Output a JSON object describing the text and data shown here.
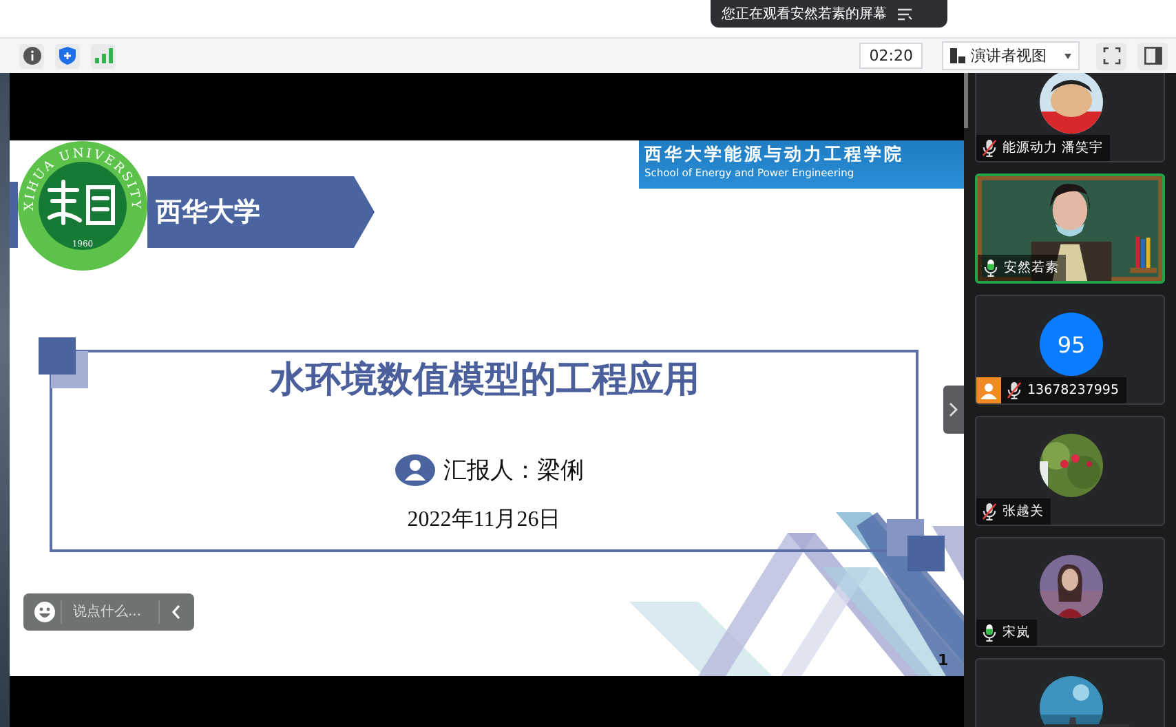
{
  "banner": {
    "text": "您正在观看安然若素的屏幕"
  },
  "toolbar": {
    "timer": "02:20",
    "view_menu": "演讲者视图"
  },
  "slide": {
    "university": "西华大学",
    "logo_ring": "XIHUA UNIVERSITY",
    "logo_year": "1960",
    "college_cn": "西华大学能源与动力工程学院",
    "college_en": "School of Energy and Power Engineering",
    "title": "水环境数值模型的工程应用",
    "presenter": "汇报人：梁俐",
    "date": "2022年11月26日",
    "page": "1"
  },
  "chat": {
    "placeholder": "说点什么..."
  },
  "participants": [
    {
      "kind": "avatar",
      "name": "能源动力 潘笑宇",
      "muted": true,
      "active": false,
      "role_badge": false
    },
    {
      "kind": "video",
      "name": "安然若素",
      "muted": false,
      "active": true,
      "role_badge": false
    },
    {
      "kind": "number",
      "avatar_text": "95",
      "name": "13678237995",
      "muted": true,
      "active": false,
      "role_badge": true
    },
    {
      "kind": "avatar",
      "name": "张越关",
      "muted": true,
      "active": false,
      "role_badge": false
    },
    {
      "kind": "avatar",
      "name": "宋岚",
      "muted": false,
      "active": false,
      "role_badge": false
    },
    {
      "kind": "avatar",
      "active": false
    }
  ]
}
